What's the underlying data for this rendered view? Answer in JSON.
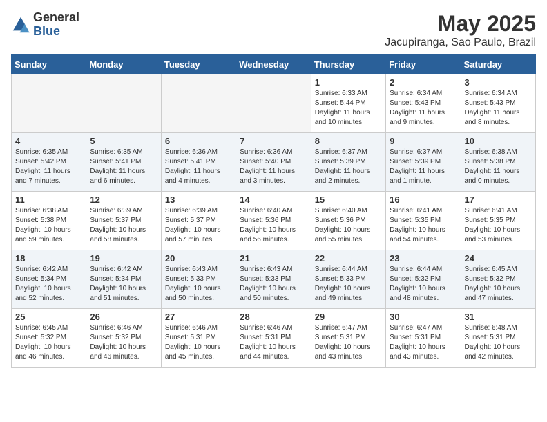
{
  "logo": {
    "general": "General",
    "blue": "Blue"
  },
  "title": "May 2025",
  "location": "Jacupiranga, Sao Paulo, Brazil",
  "days_of_week": [
    "Sunday",
    "Monday",
    "Tuesday",
    "Wednesday",
    "Thursday",
    "Friday",
    "Saturday"
  ],
  "weeks": [
    [
      {
        "day": "",
        "empty": true
      },
      {
        "day": "",
        "empty": true
      },
      {
        "day": "",
        "empty": true
      },
      {
        "day": "",
        "empty": true
      },
      {
        "day": "1",
        "sunrise": "6:33 AM",
        "sunset": "5:44 PM",
        "daylight": "11 hours and 10 minutes."
      },
      {
        "day": "2",
        "sunrise": "6:34 AM",
        "sunset": "5:43 PM",
        "daylight": "11 hours and 9 minutes."
      },
      {
        "day": "3",
        "sunrise": "6:34 AM",
        "sunset": "5:43 PM",
        "daylight": "11 hours and 8 minutes."
      }
    ],
    [
      {
        "day": "4",
        "sunrise": "6:35 AM",
        "sunset": "5:42 PM",
        "daylight": "11 hours and 7 minutes."
      },
      {
        "day": "5",
        "sunrise": "6:35 AM",
        "sunset": "5:41 PM",
        "daylight": "11 hours and 6 minutes."
      },
      {
        "day": "6",
        "sunrise": "6:36 AM",
        "sunset": "5:41 PM",
        "daylight": "11 hours and 4 minutes."
      },
      {
        "day": "7",
        "sunrise": "6:36 AM",
        "sunset": "5:40 PM",
        "daylight": "11 hours and 3 minutes."
      },
      {
        "day": "8",
        "sunrise": "6:37 AM",
        "sunset": "5:39 PM",
        "daylight": "11 hours and 2 minutes."
      },
      {
        "day": "9",
        "sunrise": "6:37 AM",
        "sunset": "5:39 PM",
        "daylight": "11 hours and 1 minute."
      },
      {
        "day": "10",
        "sunrise": "6:38 AM",
        "sunset": "5:38 PM",
        "daylight": "11 hours and 0 minutes."
      }
    ],
    [
      {
        "day": "11",
        "sunrise": "6:38 AM",
        "sunset": "5:38 PM",
        "daylight": "10 hours and 59 minutes."
      },
      {
        "day": "12",
        "sunrise": "6:39 AM",
        "sunset": "5:37 PM",
        "daylight": "10 hours and 58 minutes."
      },
      {
        "day": "13",
        "sunrise": "6:39 AM",
        "sunset": "5:37 PM",
        "daylight": "10 hours and 57 minutes."
      },
      {
        "day": "14",
        "sunrise": "6:40 AM",
        "sunset": "5:36 PM",
        "daylight": "10 hours and 56 minutes."
      },
      {
        "day": "15",
        "sunrise": "6:40 AM",
        "sunset": "5:36 PM",
        "daylight": "10 hours and 55 minutes."
      },
      {
        "day": "16",
        "sunrise": "6:41 AM",
        "sunset": "5:35 PM",
        "daylight": "10 hours and 54 minutes."
      },
      {
        "day": "17",
        "sunrise": "6:41 AM",
        "sunset": "5:35 PM",
        "daylight": "10 hours and 53 minutes."
      }
    ],
    [
      {
        "day": "18",
        "sunrise": "6:42 AM",
        "sunset": "5:34 PM",
        "daylight": "10 hours and 52 minutes."
      },
      {
        "day": "19",
        "sunrise": "6:42 AM",
        "sunset": "5:34 PM",
        "daylight": "10 hours and 51 minutes."
      },
      {
        "day": "20",
        "sunrise": "6:43 AM",
        "sunset": "5:33 PM",
        "daylight": "10 hours and 50 minutes."
      },
      {
        "day": "21",
        "sunrise": "6:43 AM",
        "sunset": "5:33 PM",
        "daylight": "10 hours and 50 minutes."
      },
      {
        "day": "22",
        "sunrise": "6:44 AM",
        "sunset": "5:33 PM",
        "daylight": "10 hours and 49 minutes."
      },
      {
        "day": "23",
        "sunrise": "6:44 AM",
        "sunset": "5:32 PM",
        "daylight": "10 hours and 48 minutes."
      },
      {
        "day": "24",
        "sunrise": "6:45 AM",
        "sunset": "5:32 PM",
        "daylight": "10 hours and 47 minutes."
      }
    ],
    [
      {
        "day": "25",
        "sunrise": "6:45 AM",
        "sunset": "5:32 PM",
        "daylight": "10 hours and 46 minutes."
      },
      {
        "day": "26",
        "sunrise": "6:46 AM",
        "sunset": "5:32 PM",
        "daylight": "10 hours and 46 minutes."
      },
      {
        "day": "27",
        "sunrise": "6:46 AM",
        "sunset": "5:31 PM",
        "daylight": "10 hours and 45 minutes."
      },
      {
        "day": "28",
        "sunrise": "6:46 AM",
        "sunset": "5:31 PM",
        "daylight": "10 hours and 44 minutes."
      },
      {
        "day": "29",
        "sunrise": "6:47 AM",
        "sunset": "5:31 PM",
        "daylight": "10 hours and 43 minutes."
      },
      {
        "day": "30",
        "sunrise": "6:47 AM",
        "sunset": "5:31 PM",
        "daylight": "10 hours and 43 minutes."
      },
      {
        "day": "31",
        "sunrise": "6:48 AM",
        "sunset": "5:31 PM",
        "daylight": "10 hours and 42 minutes."
      }
    ]
  ],
  "labels": {
    "sunrise": "Sunrise:",
    "sunset": "Sunset:",
    "daylight": "Daylight hours"
  }
}
